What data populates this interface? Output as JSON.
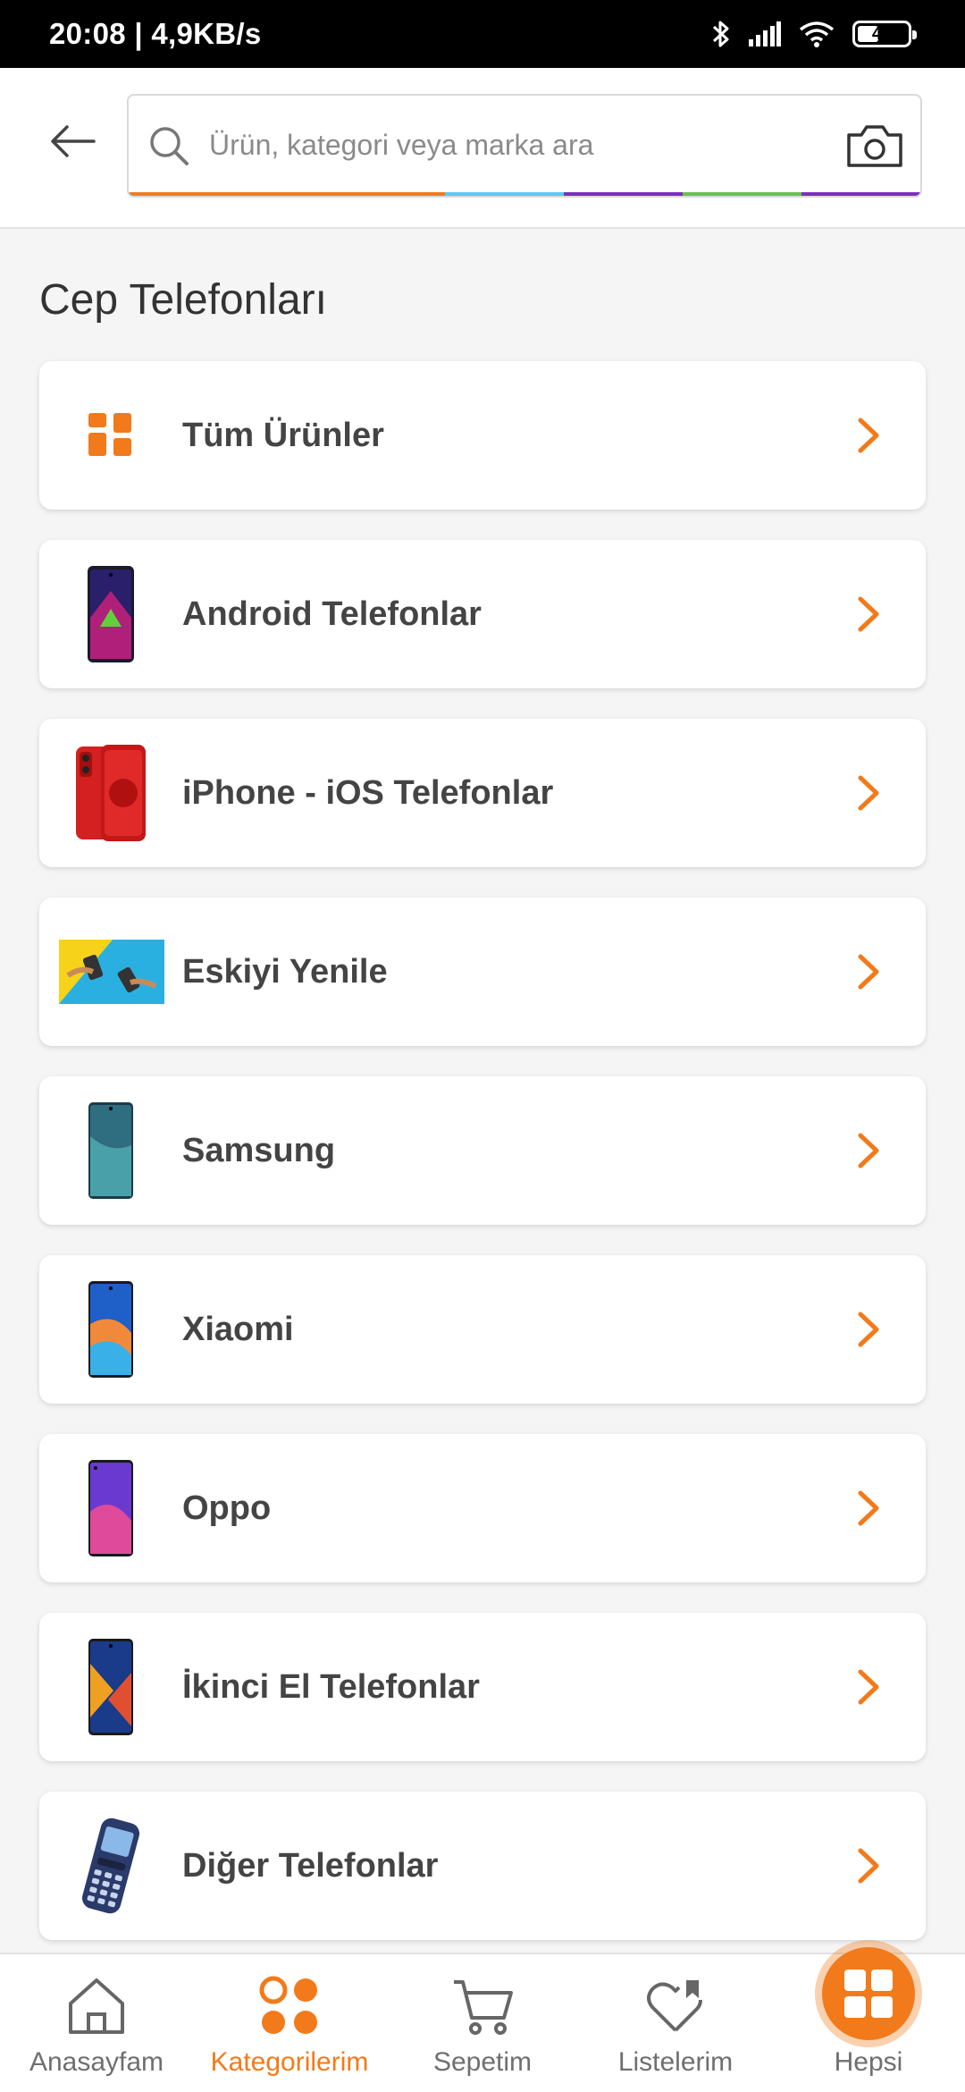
{
  "status_bar": {
    "time_speed": "20:08 | 4,9KB/s",
    "battery": "43",
    "battery_level": 0.43
  },
  "search": {
    "placeholder": "Ürün, kategori veya marka ara",
    "value": "",
    "stripe_colors": [
      "#f27a1a",
      "#5ac8fa",
      "#7b2fbe",
      "#6cc04a",
      "#7b2fbe"
    ]
  },
  "page": {
    "title": "Cep Telefonları"
  },
  "categories": [
    {
      "label": "Tüm Ürünler",
      "icon": "grid-icon"
    },
    {
      "label": "Android Telefonlar",
      "icon": "android-phone-image"
    },
    {
      "label": "iPhone - iOS Telefonlar",
      "icon": "iphone-image"
    },
    {
      "label": "Eskiyi Yenile",
      "icon": "trade-in-image"
    },
    {
      "label": "Samsung",
      "icon": "samsung-phone-image"
    },
    {
      "label": "Xiaomi",
      "icon": "xiaomi-phone-image"
    },
    {
      "label": "Oppo",
      "icon": "oppo-phone-image"
    },
    {
      "label": "İkinci El Telefonlar",
      "icon": "second-hand-phone-image"
    },
    {
      "label": "Diğer Telefonlar",
      "icon": "feature-phone-image"
    }
  ],
  "bottom_nav": [
    {
      "label": "Anasayfam",
      "icon": "home-icon",
      "active": false
    },
    {
      "label": "Kategorilerim",
      "icon": "categories-icon",
      "active": true
    },
    {
      "label": "Sepetim",
      "icon": "cart-icon",
      "active": false
    },
    {
      "label": "Listelerim",
      "icon": "heart-list-icon",
      "active": false
    },
    {
      "label": "Hepsi",
      "icon": "all-apps-icon",
      "active": false
    }
  ],
  "colors": {
    "accent": "#f27a1a",
    "text": "#333333",
    "background": "#f5f5f5"
  }
}
